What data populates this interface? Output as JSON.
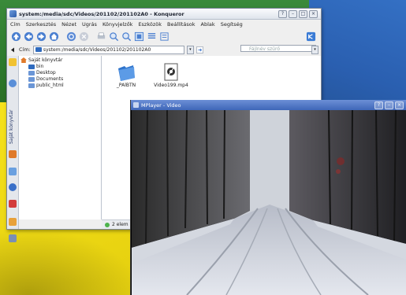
{
  "konqueror": {
    "title": "system:/media/sdc/Videos/201102/201102A0 - Konqueror",
    "window_buttons": [
      "?",
      "–",
      "□",
      "×"
    ],
    "menu": [
      "Cím",
      "Szerkesztés",
      "Nézet",
      "Ugrás",
      "Könyvjelzők",
      "Eszközök",
      "Beállítások",
      "Ablak",
      "Segítség"
    ],
    "location_label": "Cím:",
    "location_value": "system:/media/sdc/Videos/201102/201102A0",
    "filter_placeholder": "Fájlnév szűrő",
    "sidebar_tab_label": "Saját könyvtár",
    "tree": {
      "root": "Saját könyvtár",
      "items": [
        "bin",
        "Desktop",
        "Documents",
        "public_html"
      ]
    },
    "files": [
      {
        "name": "_PAlBTN",
        "icon": "folder-icon"
      },
      {
        "name": "Video199.mp4",
        "icon": "video-file-icon"
      }
    ],
    "status": "2 elem"
  },
  "mplayer": {
    "title": "MPlayer - Video",
    "window_buttons": [
      "?",
      "–",
      "×"
    ]
  },
  "colors": {
    "wallpaper_yellow": "#f3df16",
    "wallpaper_green": "#2d7a2d",
    "wallpaper_blue": "#2a5fb0",
    "mplayer_titlebar": "#3e66b8"
  }
}
